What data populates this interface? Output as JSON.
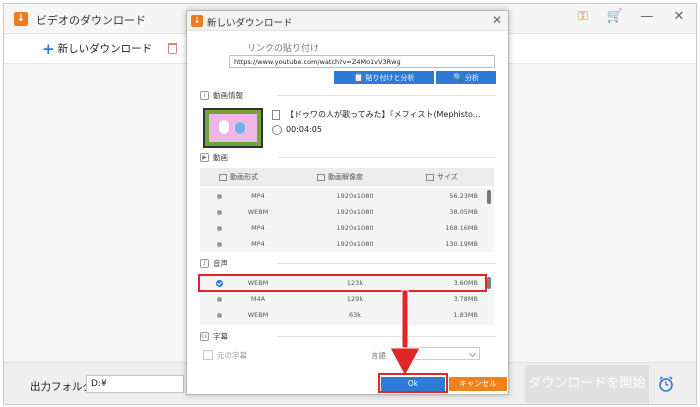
{
  "app": {
    "title": "ビデオのダウンロード",
    "new_download_label": "新しいダウンロード",
    "output_folder_label": "出力フォルダ：",
    "output_folder_value": "D:¥",
    "start_download_label": "ダウンロードを開始"
  },
  "dialog": {
    "title": "新しいダウンロード",
    "url_label": "リンクの貼り付け",
    "url_value": "https://www.youtube.com/watch?v=Z4Mo1vV3Rwg",
    "paste_analyze_label": "貼り付けと分析",
    "analyze_label": "分析",
    "video_info_label": "動画情報",
    "video_title": "【ドゥワの人が歌ってみた】『メフィスト(Mephisto...",
    "duration": "00:04:05",
    "video_section_label": "動画",
    "columns": {
      "format": "動画形式",
      "resolution": "動画解像度",
      "size": "サイズ"
    },
    "video_rows": [
      {
        "format": "MP4",
        "resolution": "1920x1080",
        "size": "56.23MB"
      },
      {
        "format": "WEBM",
        "resolution": "1920x1080",
        "size": "38.05MB"
      },
      {
        "format": "MP4",
        "resolution": "1920x1080",
        "size": "168.16MB"
      },
      {
        "format": "MP4",
        "resolution": "1920x1080",
        "size": "130.19MB"
      }
    ],
    "audio_section_label": "音声",
    "audio_rows": [
      {
        "format": "WEBM",
        "bitrate": "123k",
        "size": "3.60MB",
        "selected": true
      },
      {
        "format": "M4A",
        "bitrate": "129k",
        "size": "3.78MB",
        "selected": false
      },
      {
        "format": "WEBM",
        "bitrate": "63k",
        "size": "1.83MB",
        "selected": false
      }
    ],
    "subtitle_section_label": "字幕",
    "original_subtitle_label": "元の字幕",
    "language_label": "言語",
    "ok_label": "Ok",
    "cancel_label": "キャンセル"
  },
  "colors": {
    "accent_blue": "#2e7bd6",
    "accent_orange": "#f0821c",
    "highlight_red": "#e22525"
  }
}
